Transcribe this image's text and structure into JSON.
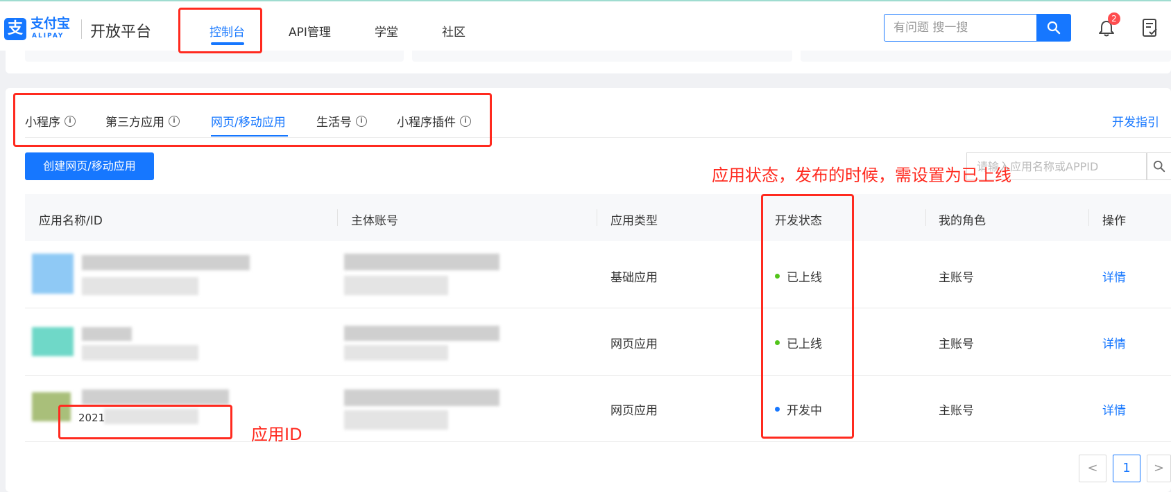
{
  "header": {
    "logo_cn": "支付宝",
    "logo_en": "ALIPAY",
    "platform": "开放平台",
    "nav": [
      "控制台",
      "API管理",
      "学堂",
      "社区"
    ],
    "search_placeholder": "有问题 搜一搜",
    "notification_count": "2",
    "accent": "#1677ff"
  },
  "tabs": {
    "items": [
      "小程序",
      "第三方应用",
      "网页/移动应用",
      "生活号",
      "小程序插件"
    ],
    "active": "网页/移动应用",
    "dev_guide": "开发指引"
  },
  "toolbar": {
    "create_label": "创建网页/移动应用",
    "search_placeholder": "请输入应用名称或APPID"
  },
  "table": {
    "columns": [
      "应用名称/ID",
      "主体账号",
      "应用类型",
      "开发状态",
      "我的角色",
      "操作"
    ],
    "rows": [
      {
        "app_id_partial": "",
        "type": "基础应用",
        "status": "已上线",
        "status_color": "#52c41a",
        "role": "主账号",
        "action": "详情"
      },
      {
        "app_id_partial": "",
        "type": "网页应用",
        "status": "已上线",
        "status_color": "#52c41a",
        "role": "主账号",
        "action": "详情"
      },
      {
        "app_id_partial": "2021",
        "type": "网页应用",
        "status": "开发中",
        "status_color": "#1677ff",
        "role": "主账号",
        "action": "详情"
      }
    ]
  },
  "pagination": {
    "prev": "<",
    "current": "1",
    "next": ">"
  },
  "annotations": {
    "status_note": "应用状态，发布的时候，需设置为已上线",
    "id_note": "应用ID",
    "color": "#ff2a1f"
  }
}
